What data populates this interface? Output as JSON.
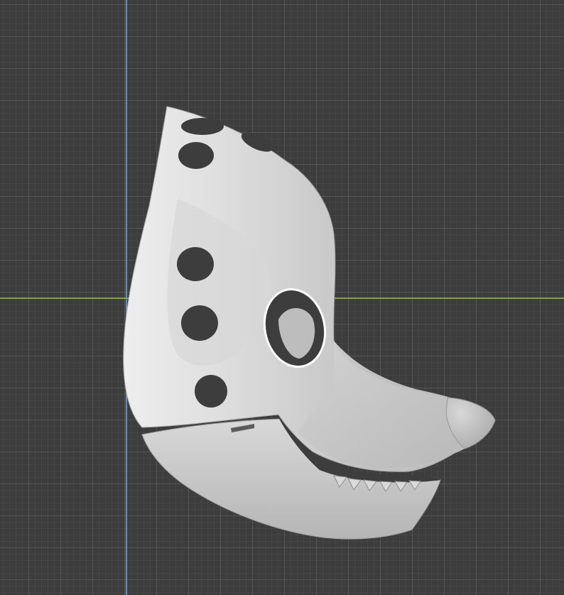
{
  "viewport": {
    "background": "#3d3d3d",
    "grid_color": "#4f4f4f",
    "axis_y_color": "#5a8fd1",
    "axis_x_color": "#7da33a"
  },
  "model": {
    "object": "mask-model",
    "surface_color": "#c7c7c7",
    "shadow_color": "#8e8e8e"
  }
}
